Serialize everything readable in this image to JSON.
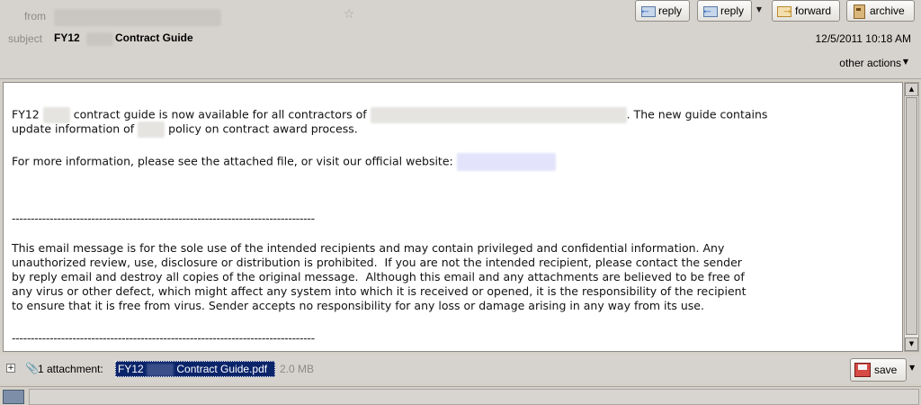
{
  "header": {
    "from_label": "from",
    "subject_label": "subject",
    "subject_prefix": "FY12",
    "subject_suffix": "Contract Guide",
    "date": "12/5/2011 10:18 AM",
    "other_actions": "other actions",
    "buttons": {
      "reply": "reply",
      "reply_all": "reply",
      "forward": "forward",
      "archive": "archive"
    }
  },
  "body": {
    "p1_a": "FY12",
    "p1_b": "contract guide is now available for all contractors of",
    "p1_c": ". The new guide contains",
    "p1_d": "update information of",
    "p1_e": "policy on contract award process.",
    "p2": "For more information, please see the attached file, or visit our official website:",
    "separator": "--------------------------------------------------------------------------------",
    "disclaimer": [
      "This email message is for the sole use of the intended recipients and may contain privileged and confidential information. Any",
      "unauthorized review, use, disclosure or distribution is prohibited.  If you are not the intended recipient, please contact the sender",
      "by reply email and destroy all copies of the original message.  Although this email and any attachments are believed to be free of",
      "any virus or other defect, which might affect any system into which it is received or opened, it is the responsibility of the recipient",
      "to ensure that it is free from virus. Sender accepts no responsibility for any loss or damage arising in any way from its use."
    ]
  },
  "attachments": {
    "count_label": "1 attachment:",
    "file_prefix": "FY12",
    "file_suffix": "Contract Guide.pdf",
    "size": "2.0 MB",
    "save_label": "save"
  }
}
